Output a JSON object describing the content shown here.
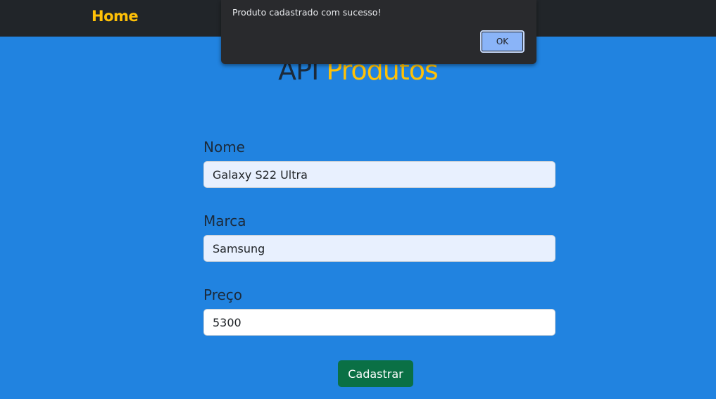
{
  "navbar": {
    "brand": "Home"
  },
  "page": {
    "title_part1": "API",
    "title_part2": "Produtos"
  },
  "form": {
    "fields": [
      {
        "label": "Nome",
        "value": "Galaxy S22 Ultra"
      },
      {
        "label": "Marca",
        "value": "Samsung"
      },
      {
        "label": "Preço",
        "value": "5300"
      }
    ],
    "submit_label": "Cadastrar"
  },
  "dialog": {
    "message": "Produto cadastrado com sucesso!",
    "ok_label": "OK"
  },
  "colors": {
    "page_background": "#2183e0",
    "navbar_background": "#212529",
    "accent_yellow": "#ffc107",
    "submit_green": "#0a7045",
    "autofill_background": "#e8f0fe"
  }
}
